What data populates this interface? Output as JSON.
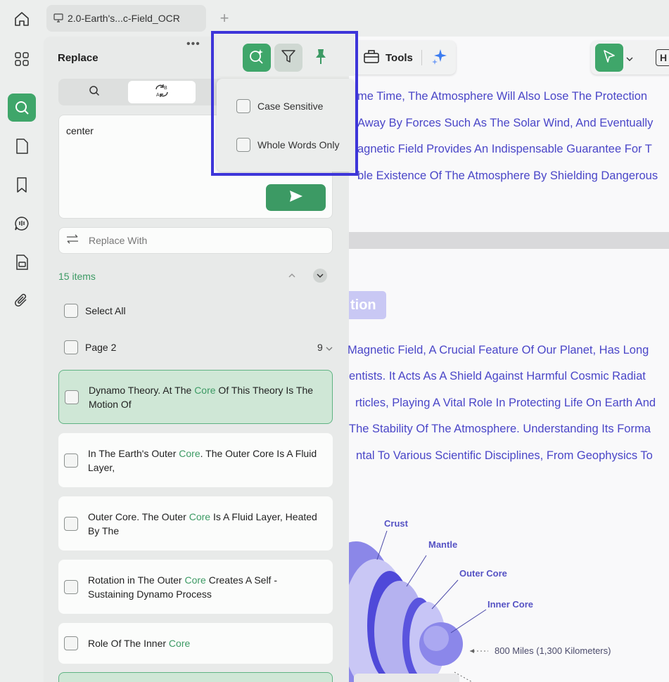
{
  "tab": {
    "title": "2.0-Earth's...c-Field_OCR"
  },
  "panel": {
    "title": "Replace",
    "find_value": "center",
    "replace_placeholder": "Replace With",
    "items_count": "15 items",
    "select_all": "Select All",
    "page_label": "Page 2",
    "page_count": "9",
    "results": [
      {
        "before": "Dynamo Theory. At The ",
        "match": "Core",
        "after": " Of This Theory Is The Motion Of"
      },
      {
        "before": "In The Earth's Outer ",
        "match": "Core",
        "after": ". The Outer Core Is A Fluid Layer,"
      },
      {
        "before": "Outer Core. The Outer ",
        "match": "Core",
        "after": " Is A Fluid Layer, Heated By The"
      },
      {
        "before": "Rotation in The Outer ",
        "match": "Core",
        "after": " Creates A Self - Sustaining Dynamo Process"
      },
      {
        "before": "Role Of The Inner ",
        "match": "Core",
        "after": ""
      }
    ]
  },
  "popover": {
    "case_sensitive": "Case Sensitive",
    "whole_words": "Whole Words Only"
  },
  "toolbar": {
    "tools_label": "Tools"
  },
  "document": {
    "lines_top": [
      "me Time, The Atmosphere Will Also Lose The Protection",
      "Away By Forces Such As The Solar Wind, And Eventually",
      "agnetic Field Provides An Indispensable Guarantee For T",
      "ble Existence Of The Atmosphere By Shielding Dangerous"
    ],
    "heading_fragment": "tion",
    "lines_bottom": [
      "Magnetic Field, A Crucial Feature Of Our Planet, Has Long",
      "entists. It Acts As A Shield Against Harmful Cosmic Radiat",
      "rticles, Playing A Vital Role In Protecting Life On Earth And",
      "The Stability Of The Atmosphere. Understanding Its Forma",
      "ntal To Various Scientific Disciplines, From Geophysics To"
    ],
    "diagram_labels": {
      "crust": "Crust",
      "mantle": "Mantle",
      "outer_core": "Outer Core",
      "inner_core": "Inner Core",
      "distance1": "800 Miles (1,300 Kilometers)"
    }
  },
  "colors": {
    "accent": "#3fa66a",
    "doc_text": "#4a46c8",
    "highlight_frame": "#3d35d9"
  }
}
